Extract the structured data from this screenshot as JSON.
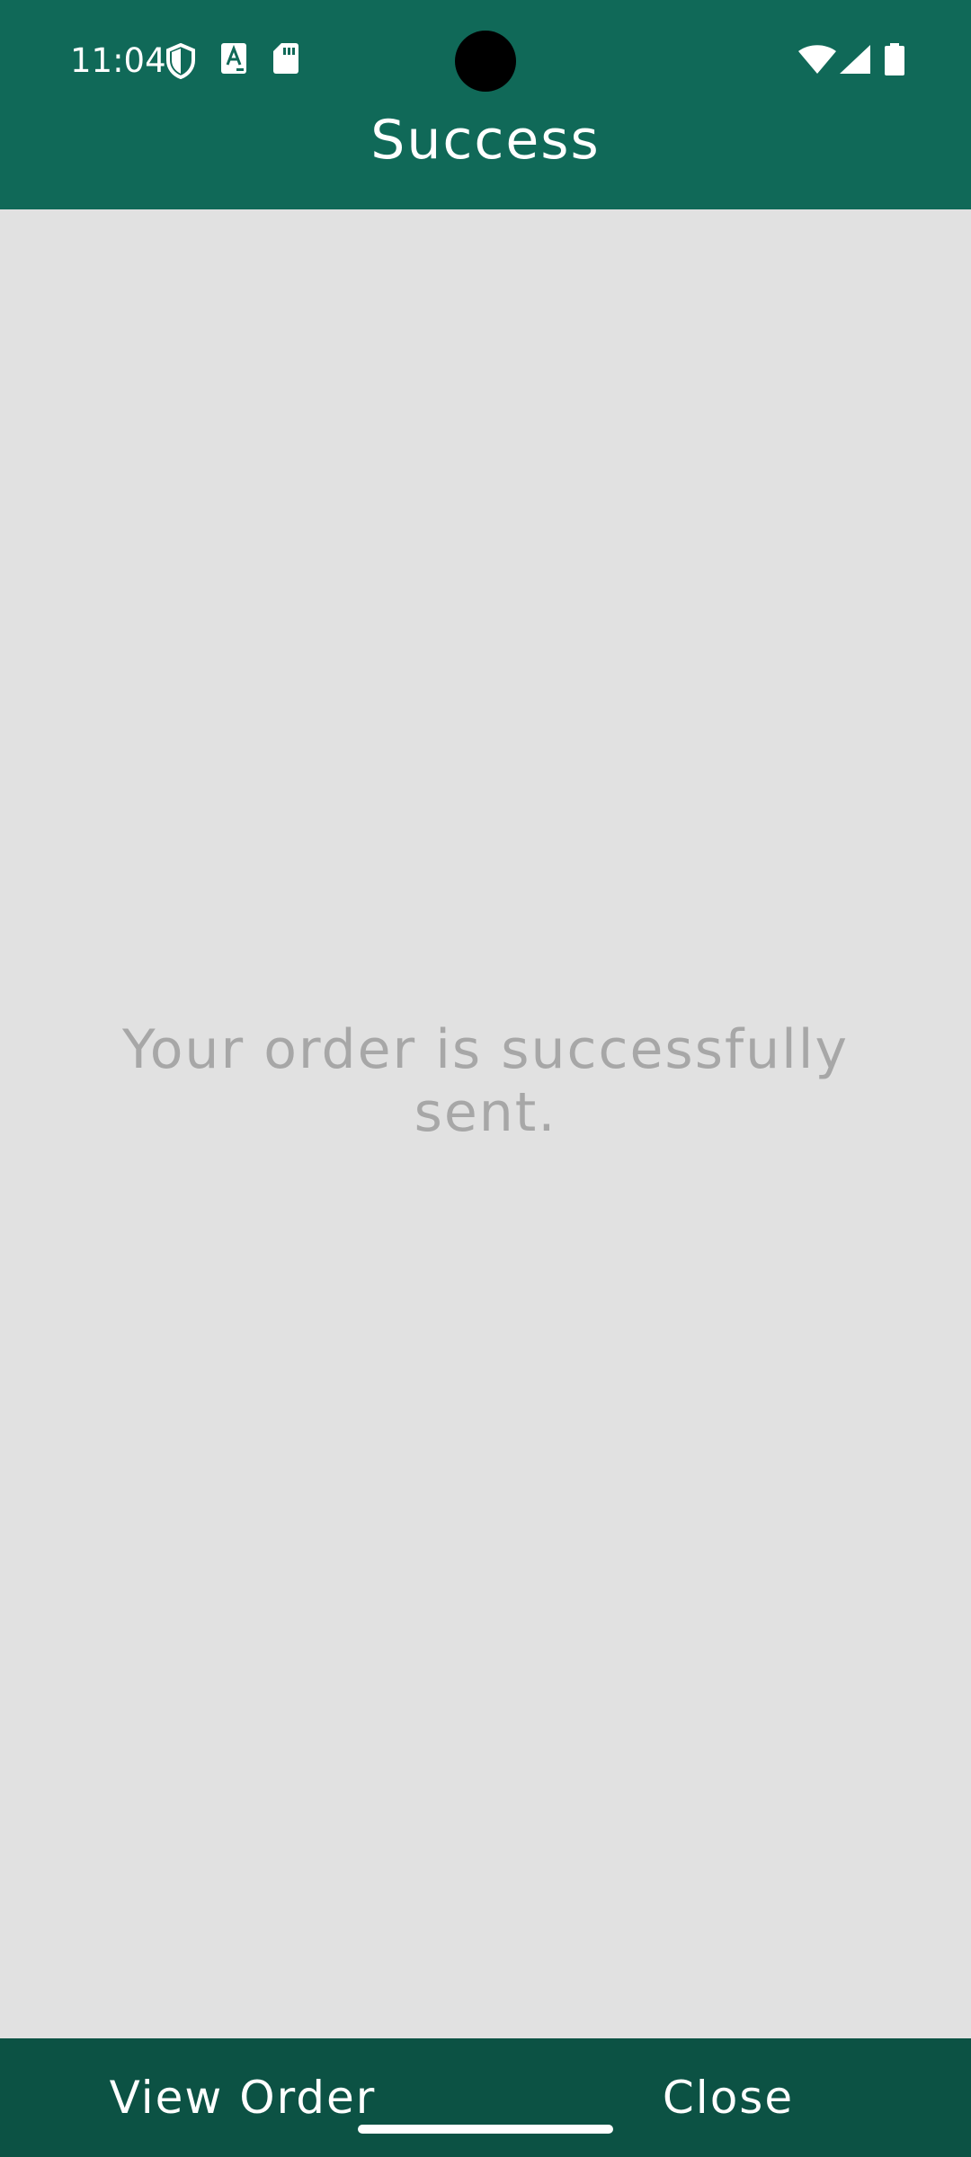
{
  "status_bar": {
    "time": "11:04",
    "left_icons": [
      "shield-icon",
      "font-a-icon",
      "sd-card-icon"
    ],
    "right_icons": [
      "wifi-icon",
      "signal-icon",
      "battery-icon"
    ]
  },
  "header": {
    "title": "Success"
  },
  "main": {
    "message": "Your order is successfully sent."
  },
  "bottom_bar": {
    "view_order_label": "View Order",
    "close_label": "Close"
  },
  "colors": {
    "primary": "#106958",
    "bottom_bar": "#0c5244",
    "background": "#e1e1e1",
    "message_text": "#a7a7a7"
  }
}
